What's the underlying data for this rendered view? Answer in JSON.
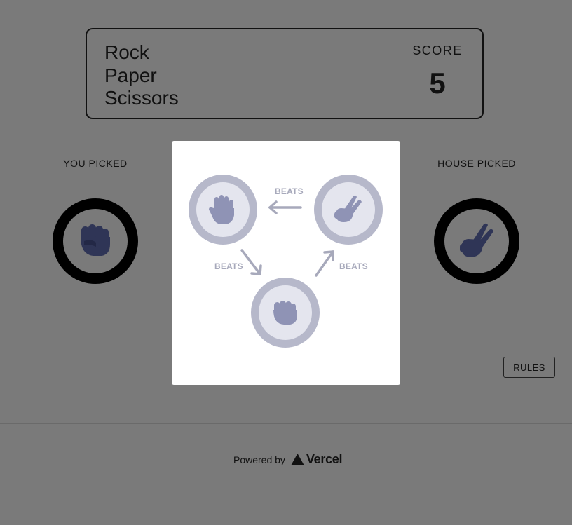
{
  "header": {
    "title_lines": [
      "Rock",
      "Paper",
      "Scissors"
    ],
    "score_label": "SCORE",
    "score_value": "5"
  },
  "player": {
    "label": "YOU PICKED",
    "choice_icon": "rock-icon"
  },
  "house": {
    "label": "HOUSE PICKED",
    "choice_icon": "scissors-icon"
  },
  "rules_modal": {
    "nodes": [
      "paper-icon",
      "scissors-icon",
      "rock-icon"
    ],
    "beats_labels": [
      "BEATS",
      "BEATS",
      "BEATS"
    ]
  },
  "rules_button": {
    "label": "RULES"
  },
  "footer": {
    "powered_by": "Powered by",
    "brand": "Vercel"
  },
  "colors": {
    "background": "#7a7a7a",
    "icon_dark": "#2f3556",
    "icon_light": "#8f93b5",
    "ring": "#b6b8ca",
    "disc": "#e4e5ee",
    "arrow": "#a7a9bb"
  }
}
